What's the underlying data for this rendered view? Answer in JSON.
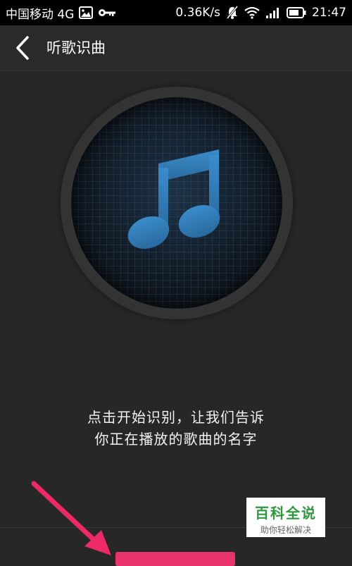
{
  "status_bar": {
    "carrier": "中国移动 4G",
    "speed": "0.36K/s",
    "time": "21:47"
  },
  "title_bar": {
    "title": "听歌识曲"
  },
  "instructions": {
    "line1": "点击开始识别，让我们告诉",
    "line2": "你正在播放的歌曲的名字"
  },
  "watermark": {
    "main": "百科全说",
    "sub": "助你轻松解决"
  },
  "icons": {
    "back": "chevron-left-icon",
    "note": "music-note-icon"
  },
  "colors": {
    "accent": "#e8336c",
    "note": "#2f78b0",
    "arrow": "#ee2a66"
  }
}
